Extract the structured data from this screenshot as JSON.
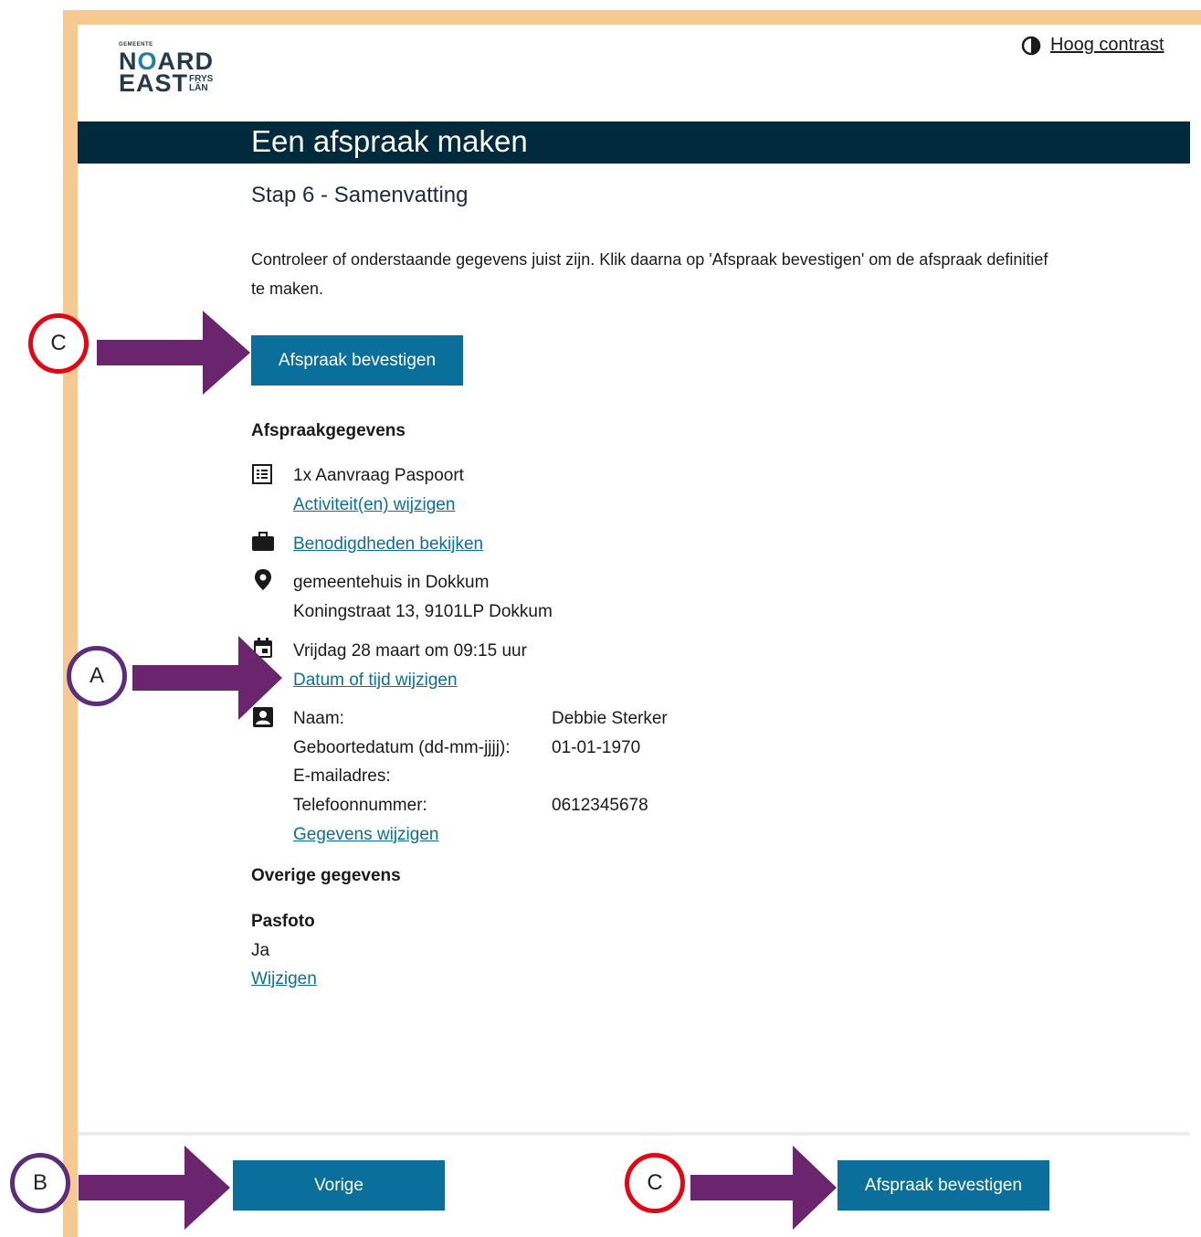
{
  "header": {
    "logo": {
      "small_text": "GEMEENTE",
      "line1": "NOARD",
      "line2": "EAST",
      "line2_suffix": "FRYS\nLÂN"
    },
    "contrast_label": "Hoog contrast",
    "contrast_icon": "contrast-icon"
  },
  "banner": {
    "title": "Een afspraak maken"
  },
  "main": {
    "step_title": "Stap 6 - Samenvatting",
    "intro": "Controleer of onderstaande gegevens juist zijn. Klik daarna op 'Afspraak bevestigen' om de afspraak definitief te maken.",
    "confirm_top_label": "Afspraak bevestigen",
    "appointment_heading": "Afspraakgegevens",
    "activity": "1x Aanvraag Paspoort",
    "activity_change": "Activiteit(en) wijzigen",
    "requirements_link": "Benodigdheden bekijken",
    "location_name": "gemeentehuis in Dokkum",
    "location_address": "Koningstraat 13, 9101LP Dokkum",
    "datetime": "Vrijdag 28 maart om 09:15 uur",
    "datetime_change": "Datum of tijd wijzigen",
    "personal": {
      "name_label": "Naam:",
      "name_value": "Debbie Sterker",
      "dob_label": "Geboortedatum (dd-mm-jjjj):",
      "dob_value": "01-01-1970",
      "email_label": "E-mailadres:",
      "email_value": "",
      "phone_label": "Telefoonnummer:",
      "phone_value": "0612345678",
      "change_link": "Gegevens wijzigen"
    },
    "other_heading": "Overige gegevens",
    "pasfoto_label": "Pasfoto",
    "pasfoto_value": "Ja",
    "pasfoto_change": "Wijzigen"
  },
  "footer": {
    "prev_label": "Vorige",
    "confirm_label": "Afspraak bevestigen"
  },
  "annotations": {
    "top_marker": "C",
    "date_marker": "A",
    "prev_marker": "B",
    "confirm_marker": "C"
  },
  "colors": {
    "frame": "#f5c98f",
    "banner": "#002b3d",
    "button": "#0b6f9c",
    "arrow": "#6b246e",
    "marker_red": "#e30613",
    "marker_purple": "#5d2c7a"
  }
}
